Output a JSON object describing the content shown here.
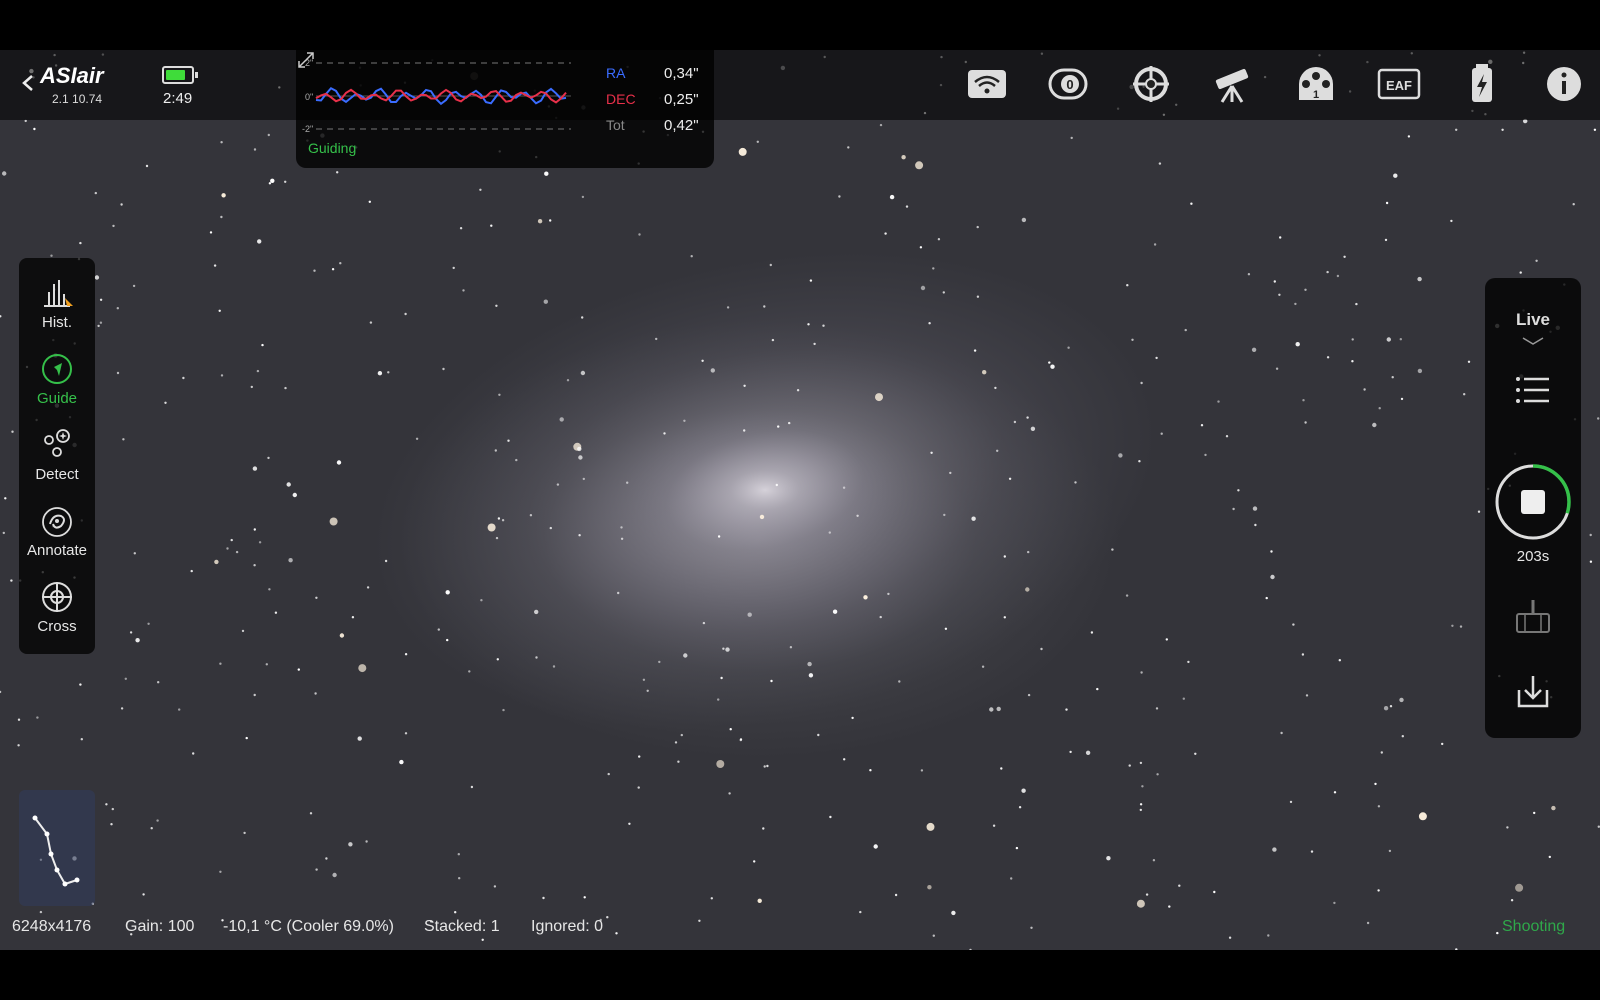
{
  "app": {
    "logo": "ASIair",
    "version": "2.1 10.74"
  },
  "status": {
    "battery_level": 0.85,
    "time": "2:49"
  },
  "guide_graph": {
    "axis_labels": [
      "2\"",
      "0\"",
      "-2\""
    ],
    "ra_label": "RA",
    "ra_value": "0,34\"",
    "dec_label": "DEC",
    "dec_value": "0,25\"",
    "tot_label": "Tot",
    "tot_value": "0,42\"",
    "state": "Guiding",
    "ra_color": "#3a6cff",
    "dec_color": "#e8304a"
  },
  "top_icons": [
    "wifi-icon",
    "camera-icon",
    "guide-scope-icon",
    "telescope-icon",
    "filter-wheel-icon",
    "eaf-icon",
    "storage-icon",
    "info-icon"
  ],
  "top_icon_texts": {
    "filter_wheel": "1",
    "eaf": "EAF"
  },
  "left_tools": [
    {
      "name": "hist",
      "label": "Hist.",
      "active": false
    },
    {
      "name": "guide",
      "label": "Guide",
      "active": true
    },
    {
      "name": "detect",
      "label": "Detect",
      "active": false
    },
    {
      "name": "annotate",
      "label": "Annotate",
      "active": false
    },
    {
      "name": "cross",
      "label": "Cross",
      "active": false
    }
  ],
  "right_panel": {
    "mode": "Live",
    "countdown": "203s",
    "progress": 0.3
  },
  "bottom_status": {
    "resolution": "6248x4176",
    "gain": "Gain: 100",
    "temperature": "-10,1 °C (Cooler 69.0%)",
    "stacked": "Stacked: 1",
    "ignored": "Ignored: 0",
    "state": "Shooting"
  },
  "colors": {
    "accent_green": "#35c04a",
    "status_green": "#2fa84a"
  }
}
